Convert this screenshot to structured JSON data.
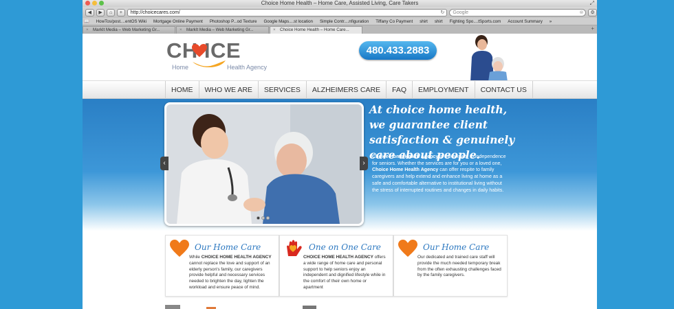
{
  "browser": {
    "window_title": "Choice Home Health – Home Care, Assisted Living, Care Takers",
    "nav_back": "◀",
    "nav_forward": "▶",
    "home_glyph": "⌂",
    "add_glyph": "+",
    "url": "http://choicecares.com/",
    "reload_glyph": "↻",
    "search_placeholder": "Google",
    "search_clear": "⊗",
    "gear_glyph": "⚙",
    "bookmarks": [
      "HowTos/post....entOS Wiki",
      "Mortgage Online Payment",
      "Photoshop P...od Texture",
      "Google Maps....st location",
      "Simple Contr....nfiguration",
      "Tiffany Co Payment",
      "shirt",
      "shirt",
      "Fighting Spo....tSports.com",
      "Account Summary"
    ],
    "tabs": [
      {
        "label": "MarkIt Media – Web Marketing Gr..."
      },
      {
        "label": "MarkIt Media – Web Marketing Gr..."
      },
      {
        "label": "Choice Home Health – Home Care..."
      }
    ],
    "tab_close": "×",
    "tab_add": "+",
    "more": "»"
  },
  "site": {
    "logo_word": "CH ICE",
    "logo_home": "Home",
    "logo_agency": "Health Agency",
    "phone": "480.433.2883",
    "nav": [
      "HOME",
      "WHO WE ARE",
      "SERVICES",
      "ALZHEIMERS CARE",
      "FAQ",
      "EMPLOYMENT",
      "CONTACT US"
    ],
    "hero": {
      "tagline": "At choice home health, we guarantee client satisfaction & genuinely care about people.",
      "intro_bold_1": "Choice Home Health Agency",
      "intro_text_1": " is the answer to independence for seniors. Whether the services are for you or a loved one, ",
      "intro_bold_2": "Choice Home Health Agency",
      "intro_text_2": " can offer respite to family caregivers and help extend and enhance living at home as a safe and comfortable alternative to institutional living without the stress of interrupted routines and changes in daily habits."
    },
    "cards": [
      {
        "icon": "heart-icon",
        "title": "Our Home Care",
        "body_pre": "While ",
        "body_bold": "CHOICE HOME HEALTH AGENCY",
        "body_post": " cannot replace the love and support of an elderly person's family, our caregivers provide helpful and necessary services needed to brighten the day, lighten the workload and ensure peace of mind."
      },
      {
        "icon": "hand-heart-icon",
        "title": "One on One Care",
        "body_pre": "",
        "body_bold": "CHOICE HOME HEALTH AGENCY",
        "body_post": " offers a wide range of home care and personal support to help seniors enjoy an independent and dignified lifestyle while in the comfort of their own home or apartment"
      },
      {
        "icon": "heart-icon",
        "title": "Our Home Care",
        "body_pre": "",
        "body_bold": "",
        "body_post": "Our dedicated and trained care staff will provide the much needed temporary break from the often exhausting challenges faced by the family caregivers."
      }
    ],
    "colors": {
      "accent_blue": "#2c78c0",
      "heart_orange": "#f07a1a",
      "hero_blue": "#2a7fc5"
    }
  }
}
